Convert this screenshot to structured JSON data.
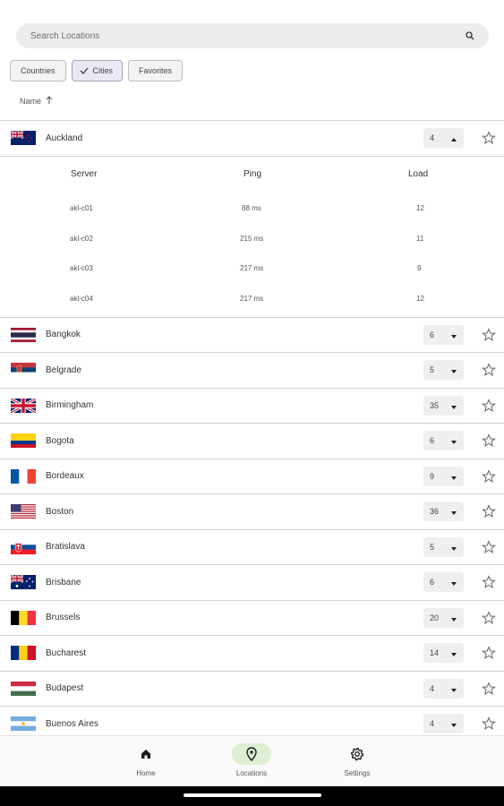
{
  "search": {
    "placeholder": "Search Locations"
  },
  "filters": [
    {
      "label": "Countries",
      "selected": false
    },
    {
      "label": "Cities",
      "selected": true
    },
    {
      "label": "Favorites",
      "selected": false
    }
  ],
  "sort": {
    "label": "Name",
    "direction": "ascending"
  },
  "expanded": {
    "city": "Auckland",
    "count": "4",
    "columns": [
      "Server",
      "Ping",
      "Load"
    ],
    "servers": [
      {
        "name": "akl-c01",
        "ping": "88 ms",
        "load": "12"
      },
      {
        "name": "akl-c02",
        "ping": "215 ms",
        "load": "11"
      },
      {
        "name": "akl-c03",
        "ping": "217 ms",
        "load": "9"
      },
      {
        "name": "akl-c04",
        "ping": "217 ms",
        "load": "12"
      }
    ]
  },
  "cities": [
    {
      "name": "Bangkok",
      "count": "6",
      "flag": "thailand"
    },
    {
      "name": "Belgrade",
      "count": "5",
      "flag": "serbia"
    },
    {
      "name": "Birmingham",
      "count": "35",
      "flag": "united-kingdom"
    },
    {
      "name": "Bogota",
      "count": "6",
      "flag": "colombia"
    },
    {
      "name": "Bordeaux",
      "count": "9",
      "flag": "france"
    },
    {
      "name": "Boston",
      "count": "36",
      "flag": "united-states"
    },
    {
      "name": "Bratislava",
      "count": "5",
      "flag": "slovakia"
    },
    {
      "name": "Brisbane",
      "count": "6",
      "flag": "australia"
    },
    {
      "name": "Brussels",
      "count": "20",
      "flag": "belgium"
    },
    {
      "name": "Bucharest",
      "count": "14",
      "flag": "romania"
    },
    {
      "name": "Budapest",
      "count": "4",
      "flag": "hungary"
    },
    {
      "name": "Buenos Aires",
      "count": "4",
      "flag": "argentina"
    }
  ],
  "nav": [
    {
      "label": "Home",
      "icon": "home-icon",
      "active": false
    },
    {
      "label": "Locations",
      "icon": "location-pin-icon",
      "active": true
    },
    {
      "label": "Settings",
      "icon": "gear-icon",
      "active": false
    }
  ],
  "colors": {
    "active_nav_pill": "#dcefd2",
    "selected_chip": "#ebe7f5",
    "search_bg": "#ececec"
  }
}
